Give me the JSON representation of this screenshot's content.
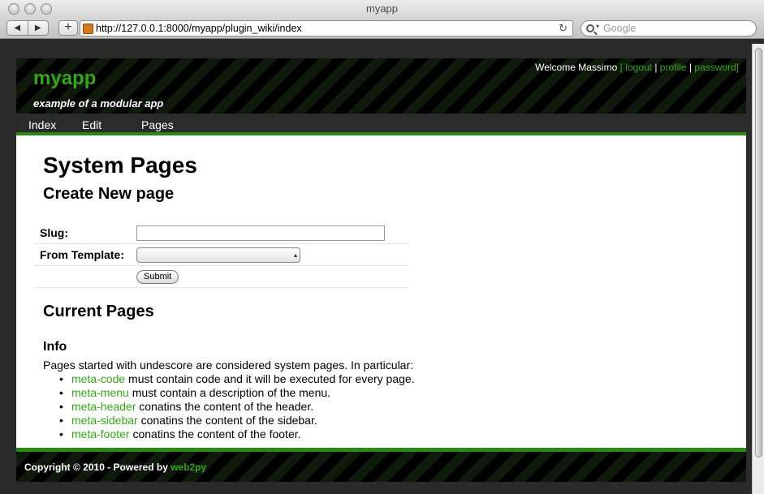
{
  "browser": {
    "title": "myapp",
    "url": "http://127.0.0.1:8000/myapp/plugin_wiki/index",
    "search_placeholder": "Google",
    "back_icon": "triangle-left",
    "forward_icon": "triangle-right",
    "add_icon": "plus",
    "reload_icon": "circular-arrow"
  },
  "header": {
    "logo": "myapp",
    "subtitle": "example of a modular app",
    "welcome": "Welcome Massimo",
    "auth_links": [
      "logout",
      "profile",
      "password"
    ],
    "accent_color": "#37a51c"
  },
  "nav": {
    "items": [
      "Index",
      "Edit",
      "Pages"
    ]
  },
  "main": {
    "title": "System Pages",
    "create_heading": "Create New page",
    "form": {
      "slug_label": "Slug:",
      "slug_value": "",
      "template_label": "From Template:",
      "template_value": "",
      "submit_label": "Submit"
    },
    "current_heading": "Current Pages",
    "info_heading": "Info",
    "info_intro": "Pages started with undescore are considered system pages. In particular:",
    "meta_items": [
      {
        "link": "meta-code",
        "text": " must contain code and it will be executed for every page."
      },
      {
        "link": "meta-menu",
        "text": " must contain a description of the menu."
      },
      {
        "link": "meta-header",
        "text": " conatins the content of the header."
      },
      {
        "link": "meta-sidebar",
        "text": " conatins the content of the sidebar."
      },
      {
        "link": "meta-footer",
        "text": " conatins the content of the footer."
      }
    ]
  },
  "footer": {
    "copyright": "Copyright © 2010 - Powered by ",
    "link": "web2py"
  }
}
